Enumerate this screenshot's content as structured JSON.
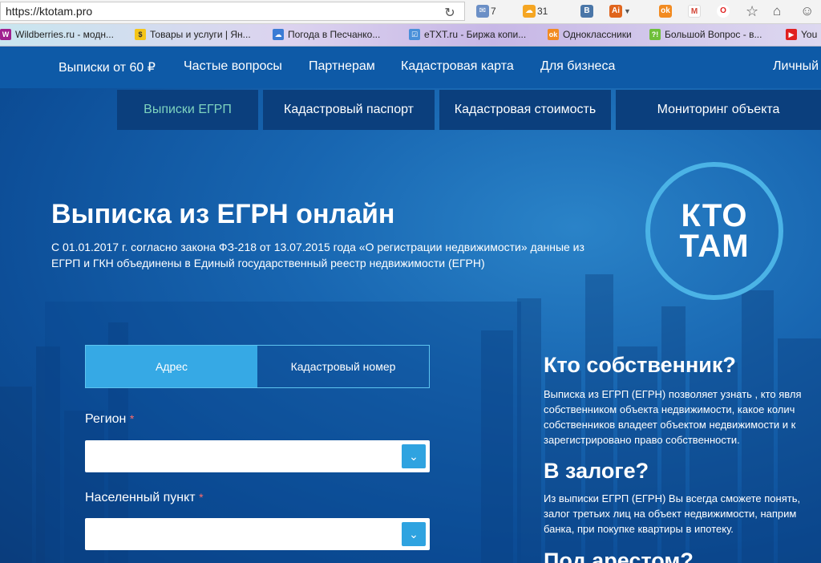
{
  "browser": {
    "url": "https://ktotam.pro",
    "extensions": [
      {
        "icon": "mail-icon",
        "count": "7"
      },
      {
        "icon": "weather-icon",
        "count": "31"
      },
      {
        "icon": "vk-icon",
        "label": "B"
      },
      {
        "icon": "ai-icon",
        "label": "Ai"
      }
    ],
    "bookmarks": [
      {
        "icon": "wildberries-icon",
        "label": "Wildberries.ru - модн..."
      },
      {
        "icon": "yandex-market-icon",
        "label": "Товары и услуги | Ян..."
      },
      {
        "icon": "weather-bookmark-icon",
        "label": "Погода в Песчанко..."
      },
      {
        "icon": "etxt-icon",
        "label": "eTXT.ru - Биржа копи..."
      },
      {
        "icon": "odnoklassniki-icon",
        "label": "Одноклассники"
      },
      {
        "icon": "bigquestion-icon",
        "label": "Большой Вопрос - в..."
      },
      {
        "icon": "youtube-icon",
        "label": "You"
      }
    ]
  },
  "nav": {
    "items": [
      "Выписки от 60 ₽",
      "Частые вопросы",
      "Партнерам",
      "Кадастровая карта",
      "Для бизнеса",
      "Личный"
    ]
  },
  "subnav": {
    "items": [
      "Выписки ЕГРП",
      "Кадастровый паспорт",
      "Кадастровая стоимость",
      "Мониторинг объекта"
    ]
  },
  "hero": {
    "title": "Выписка из ЕГРН онлайн",
    "desc_line1": "С 01.01.2017 г. согласно закона ФЗ-218 от 13.07.2015 года «О регистрации недвижимости» данные из",
    "desc_line2": "ЕГРП и ГКН объединены в Единый государственный реестр недвижимости (ЕГРН)"
  },
  "logo": {
    "line1": "КТО",
    "line2": "ТАМ"
  },
  "form": {
    "tab_address": "Адрес",
    "tab_cadastral": "Кадастровый номер",
    "region_label": "Регион",
    "city_label": "Населенный пункт",
    "required_mark": "*"
  },
  "side": {
    "owner_title": "Кто собственник?",
    "owner_lines": [
      "Выписка из ЕГРП (ЕГРН) позволяет узнать , кто явля",
      "собственником объекта недвижимости, какое колич",
      "собственников владеет объектом недвижимости и к",
      "зарегистрировано право собственности."
    ],
    "pledge_title": "В залоге?",
    "pledge_lines": [
      "Из выписки ЕГРП (ЕГРН) Вы всегда сможете понять,",
      "залог третьих лиц на объект недвижимости, наприм",
      "банка, при покупке квартиры в ипотеку."
    ],
    "arrest_title": "Под арестом?"
  }
}
